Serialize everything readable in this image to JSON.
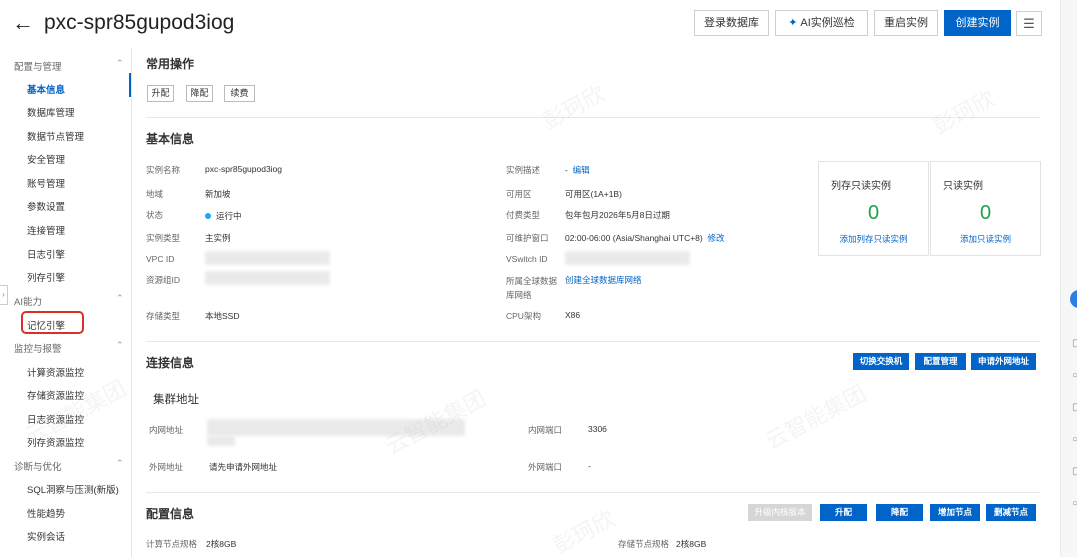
{
  "header": {
    "title": "pxc-spr85gupod3iog",
    "buttons": {
      "login_db": "登录数据库",
      "ai_inspect": "AI实例巡检",
      "restart": "重启实例",
      "create": "创建实例"
    }
  },
  "sidebar": {
    "groups": [
      {
        "label": "配置与管理",
        "items": [
          "基本信息",
          "数据库管理",
          "数据节点管理",
          "安全管理",
          "账号管理",
          "参数设置",
          "连接管理",
          "日志引擎",
          "列存引擎"
        ]
      },
      {
        "label": "AI能力",
        "items": [
          "记忆引擎"
        ]
      },
      {
        "label": "监控与报警",
        "items": [
          "计算资源监控",
          "存储资源监控",
          "日志资源监控",
          "列存资源监控"
        ]
      },
      {
        "label": "诊断与优化",
        "items": [
          "SQL洞察与压测(新版)",
          "性能趋势",
          "实例会话"
        ]
      }
    ],
    "active_item": "基本信息"
  },
  "common_ops": {
    "title": "常用操作",
    "buttons": [
      "升配",
      "降配",
      "续费"
    ]
  },
  "basic_info": {
    "title": "基本信息",
    "left": [
      {
        "label": "实例名称",
        "value": "pxc-spr85gupod3iog"
      },
      {
        "label": "地域",
        "value": "新加坡"
      },
      {
        "label": "状态",
        "value": "运行中"
      },
      {
        "label": "实例类型",
        "value": "主实例"
      },
      {
        "label": "VPC ID",
        "value": ""
      },
      {
        "label": "资源组ID",
        "value": ""
      },
      {
        "label": "存储类型",
        "value": "本地SSD"
      }
    ],
    "right": [
      {
        "label": "实例描述",
        "value": "-",
        "link": "编辑"
      },
      {
        "label": "可用区",
        "value": "可用区(1A+1B)"
      },
      {
        "label": "付费类型",
        "value": "包年包月2026年5月8日过期"
      },
      {
        "label": "可维护窗口",
        "value": "02:00-06:00 (Asia/Shanghai UTC+8)",
        "link": "修改"
      },
      {
        "label": "VSwitch ID",
        "value": ""
      },
      {
        "label": "所属全球数据库网络",
        "label_line1": "所属全球数据",
        "label_line2": "库网络",
        "value": "",
        "link": "创建全球数据库网络"
      },
      {
        "label": "CPU架构",
        "value": "X86"
      }
    ],
    "cards": [
      {
        "title": "列存只读实例",
        "count": "0",
        "link": "添加列存只读实例"
      },
      {
        "title": "只读实例",
        "count": "0",
        "link": "添加只读实例"
      }
    ]
  },
  "connection": {
    "title": "连接信息",
    "buttons": [
      "切换交换机",
      "配置管理",
      "申请外网地址"
    ],
    "cluster_title": "集群地址",
    "rows": [
      {
        "label": "内网地址",
        "value": "",
        "port_label": "内网端口",
        "port_value": "3306"
      },
      {
        "label": "外网地址",
        "value": "请先申请外网地址",
        "port_label": "外网端口",
        "port_value": "-"
      }
    ]
  },
  "config": {
    "title": "配置信息",
    "buttons": [
      "升级内核版本",
      "升配",
      "降配",
      "增加节点",
      "删减节点"
    ],
    "compute_label": "计算节点规格",
    "compute_value": "2核8GB",
    "storage_label": "存储节点规格",
    "storage_value": "2核8GB"
  },
  "watermarks": [
    "彭珂欣",
    "云智能集团"
  ],
  "colors": {
    "primary": "#0064c8",
    "highlight": "#d9302c",
    "success": "#1aa34a"
  }
}
